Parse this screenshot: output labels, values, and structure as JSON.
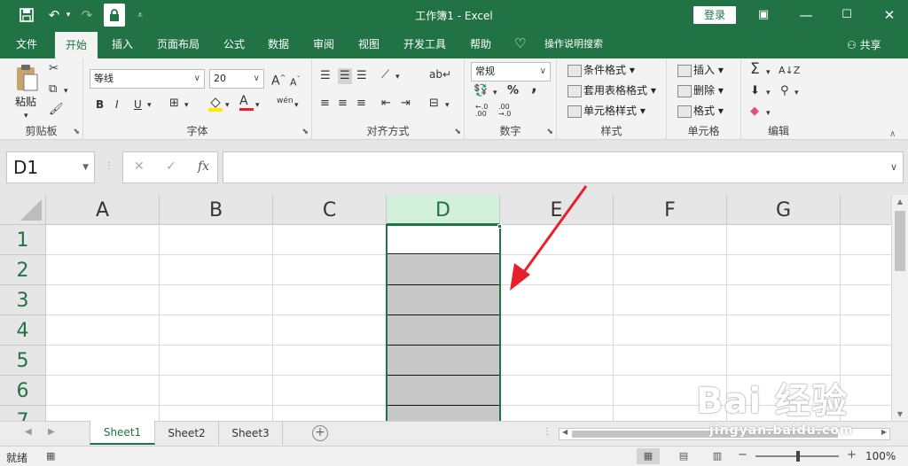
{
  "titlebar": {
    "title": "工作簿1 - Excel",
    "login": "登录",
    "icons": [
      "save-icon",
      "undo-icon",
      "redo-icon",
      "lock-icon",
      "customize-icon",
      "ribbon-display-icon",
      "minimize-icon",
      "maximize-icon",
      "close-icon"
    ]
  },
  "tabs": {
    "items": [
      "文件",
      "开始",
      "插入",
      "页面布局",
      "公式",
      "数据",
      "审阅",
      "视图",
      "开发工具",
      "帮助"
    ],
    "active": "开始",
    "tell_me": "操作说明搜索",
    "share": "共享"
  },
  "ribbon": {
    "clipboard": {
      "paste": "粘贴",
      "label": "剪贴板"
    },
    "font": {
      "name": "等线",
      "size": "20",
      "bold": "B",
      "italic": "I",
      "underline": "U",
      "grow": "A",
      "shrink": "A",
      "color_letter": "A",
      "wen": "wén",
      "label": "字体"
    },
    "alignment": {
      "label": "对齐方式"
    },
    "number": {
      "format": "常规",
      "percent": "%",
      "comma": ",",
      "inc": "←.0\n.00",
      "dec": ".00\n→.0",
      "label": "数字"
    },
    "styles": {
      "conditional": "条件格式",
      "table": "套用表格格式",
      "cell": "单元格样式",
      "label": "样式"
    },
    "cells": {
      "insert": "插入",
      "delete": "删除",
      "format": "格式",
      "label": "单元格"
    },
    "editing": {
      "label": "编辑"
    }
  },
  "formula_bar": {
    "name_box": "D1",
    "cancel": "✕",
    "enter": "✓",
    "fx": "fx",
    "value": ""
  },
  "grid": {
    "columns": [
      "A",
      "B",
      "C",
      "D",
      "E",
      "F",
      "G"
    ],
    "rows": [
      "1",
      "2",
      "3",
      "4",
      "5",
      "6",
      "7"
    ],
    "selected_column": "D",
    "active_cell": "D1",
    "shaded_range": "D2:D7"
  },
  "sheets": {
    "tabs": [
      "Sheet1",
      "Sheet2",
      "Sheet3"
    ],
    "active": "Sheet1",
    "add": "+"
  },
  "status": {
    "ready": "就绪",
    "zoom": "100%",
    "minus": "−",
    "plus": "+"
  },
  "watermark": {
    "main": "Bai 经验",
    "sub": "jingyan.baidu.com"
  },
  "colors": {
    "accent": "#217346",
    "selected_header": "#d2f0dc",
    "shaded_cell": "#c8c8c8",
    "arrow": "#e8202a"
  }
}
